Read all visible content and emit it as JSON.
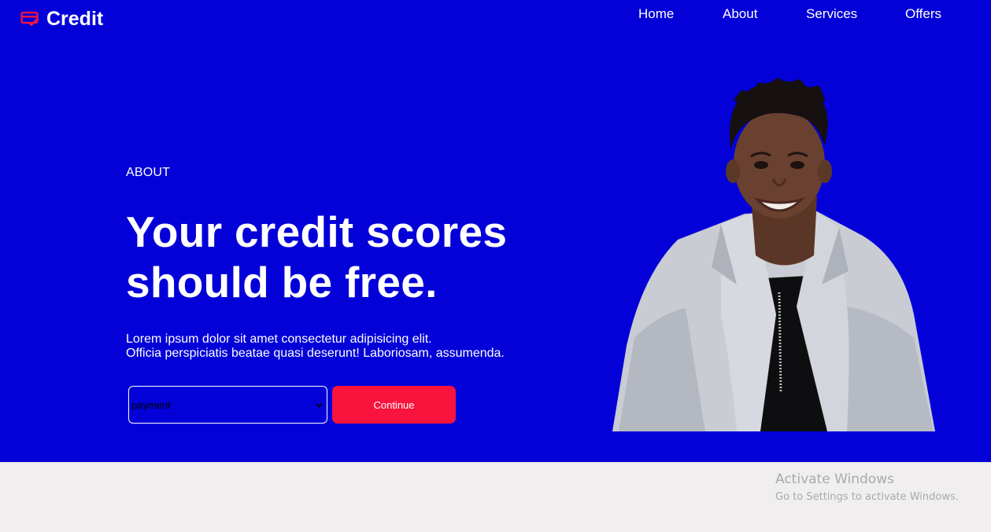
{
  "brand": {
    "name": "Credit",
    "icon": "credit-card-check-icon",
    "icon_color": "#f8143d"
  },
  "nav": {
    "items": [
      "Home",
      "About",
      "Services",
      "Offers"
    ]
  },
  "hero": {
    "background": "#0300d8",
    "eyebrow": "ABOUT",
    "headline_line1": "Your credit scores",
    "headline_line2": "should be free.",
    "description_line1": "Lorem ipsum dolor sit amet consectetur adipisicing elit.",
    "description_line2": "Officia perspiciatis beatae quasi deserunt! Laboriosam, assumenda.",
    "select": {
      "selected": "payment",
      "options": [
        "payment"
      ]
    },
    "cta_label": "Continue",
    "cta_color": "#f8143d",
    "portrait": "smiling-woman-in-grey-blazer-photo"
  },
  "watermark": {
    "title": "Activate Windows",
    "subtitle": "Go to Settings to activate Windows."
  }
}
